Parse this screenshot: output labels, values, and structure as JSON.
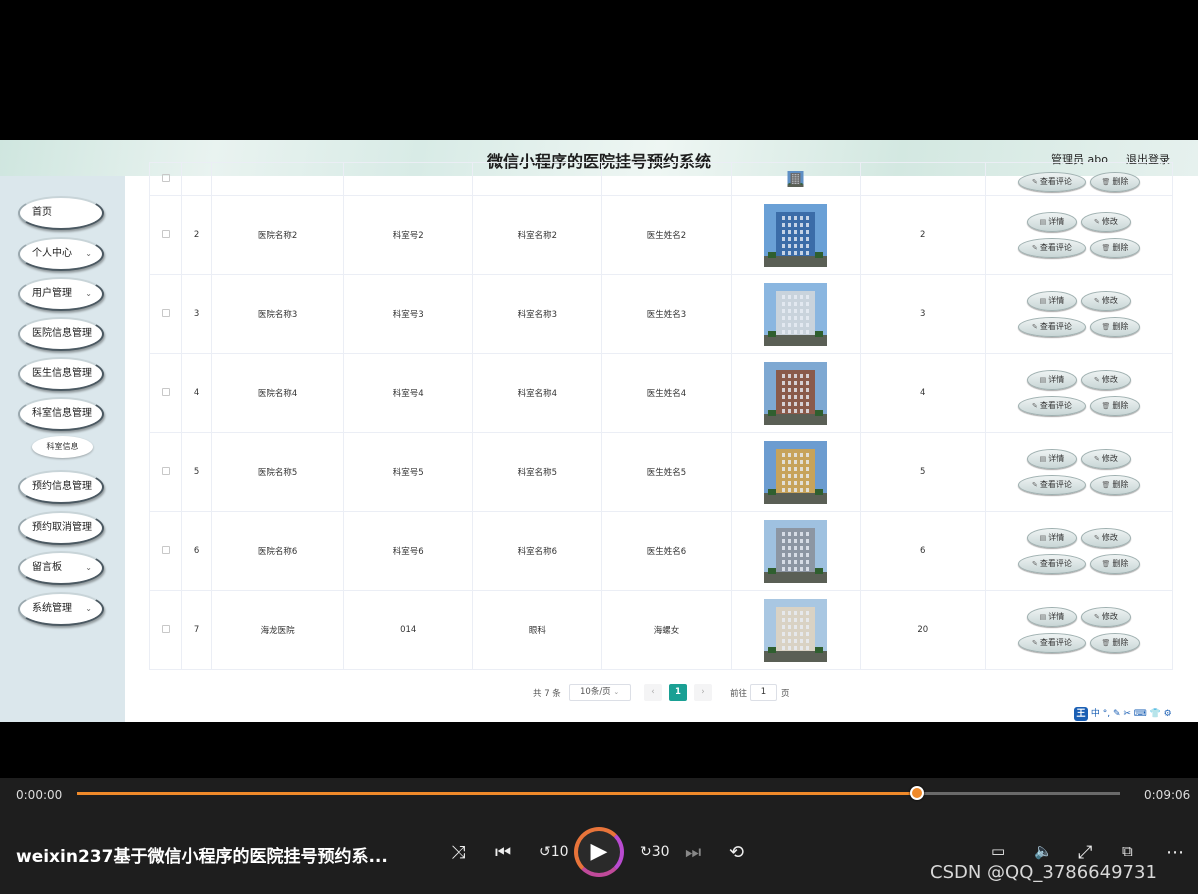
{
  "app": {
    "title": "微信小程序的医院挂号预约系统",
    "user": "管理员 abo",
    "logout": "退出登录"
  },
  "menu": [
    {
      "label": "首页",
      "chev": false
    },
    {
      "label": "个人中心",
      "chev": true
    },
    {
      "label": "用户管理",
      "chev": true
    },
    {
      "label": "医院信息管理",
      "chev": false
    },
    {
      "label": "医生信息管理",
      "chev": false
    },
    {
      "label": "科室信息管理",
      "chev": false
    },
    {
      "label": "预约信息管理",
      "chev": false
    },
    {
      "label": "预约取消管理",
      "chev": false
    },
    {
      "label": "留言板",
      "chev": true
    },
    {
      "label": "系统管理",
      "chev": true
    }
  ],
  "submenu": "科室信息",
  "rows": [
    {
      "no": "",
      "hospital": "",
      "dept_no": "",
      "dept_name": "",
      "doctor": "",
      "count": ""
    },
    {
      "no": "2",
      "hospital": "医院名称2",
      "dept_no": "科室号2",
      "dept_name": "科室名称2",
      "doctor": "医生姓名2",
      "count": "2"
    },
    {
      "no": "3",
      "hospital": "医院名称3",
      "dept_no": "科室号3",
      "dept_name": "科室名称3",
      "doctor": "医生姓名3",
      "count": "3"
    },
    {
      "no": "4",
      "hospital": "医院名称4",
      "dept_no": "科室号4",
      "dept_name": "科室名称4",
      "doctor": "医生姓名4",
      "count": "4"
    },
    {
      "no": "5",
      "hospital": "医院名称5",
      "dept_no": "科室号5",
      "dept_name": "科室名称5",
      "doctor": "医生姓名5",
      "count": "5"
    },
    {
      "no": "6",
      "hospital": "医院名称6",
      "dept_no": "科室号6",
      "dept_name": "科室名称6",
      "doctor": "医生姓名6",
      "count": "6"
    },
    {
      "no": "7",
      "hospital": "海龙医院",
      "dept_no": "014",
      "dept_name": "眼科",
      "doctor": "海螺女",
      "count": "20"
    }
  ],
  "actions": {
    "detail": "详情",
    "edit": "修改",
    "comments": "查看评论",
    "delete": "删除"
  },
  "pager": {
    "total": "共 7 条",
    "size": "10条/页",
    "current": "1",
    "goto": "前往",
    "goto_value": "1",
    "page": "页"
  },
  "ime": "中 °, ✎ ✂ ⌨ 👕 ⚙",
  "player": {
    "time_current": "0:00:00",
    "time_total": "0:09:06",
    "progress": 0.805,
    "video_title": "weixin237基于微信小程序的医院挂号预约系...",
    "watermark": "CSDN @QQ_3786649731"
  }
}
